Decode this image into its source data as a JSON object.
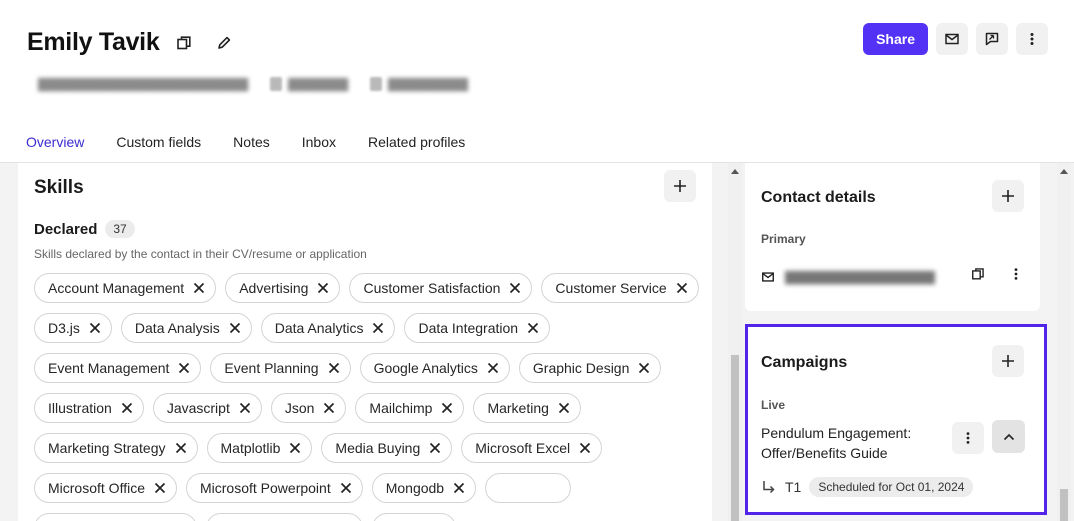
{
  "profile": {
    "name": "Emily Tavik"
  },
  "header": {
    "share_label": "Share"
  },
  "tabs": [
    {
      "label": "Overview"
    },
    {
      "label": "Custom fields"
    },
    {
      "label": "Notes"
    },
    {
      "label": "Inbox"
    },
    {
      "label": "Related profiles"
    }
  ],
  "skills": {
    "title": "Skills",
    "declared_label": "Declared",
    "declared_count": "37",
    "declared_description": "Skills declared by the contact in their CV/resume or application",
    "chips": [
      "Account Management",
      "Advertising",
      "Customer Satisfaction",
      "Customer Service",
      "D3.js",
      "Data Analysis",
      "Data Analytics",
      "Data Integration",
      "Event Management",
      "Event Planning",
      "Google Analytics",
      "Graphic Design",
      "Illustration",
      "Javascript",
      "Json",
      "Mailchimp",
      "Marketing",
      "Marketing Strategy",
      "Matplotlib",
      "Media Buying",
      "Microsoft Excel",
      "Microsoft Office",
      "Microsoft Powerpoint",
      "Mongodb"
    ]
  },
  "contact_details": {
    "title": "Contact details",
    "primary_label": "Primary"
  },
  "campaigns": {
    "title": "Campaigns",
    "live_label": "Live",
    "campaign_name": "Pendulum Engagement: Offer/Benefits Guide",
    "step_label": "T1",
    "schedule_badge": "Scheduled for Oct 01, 2024"
  },
  "colors": {
    "accent": "#5331f5",
    "highlight_border": "#5124e8",
    "active_tab": "#3b2bd1"
  }
}
